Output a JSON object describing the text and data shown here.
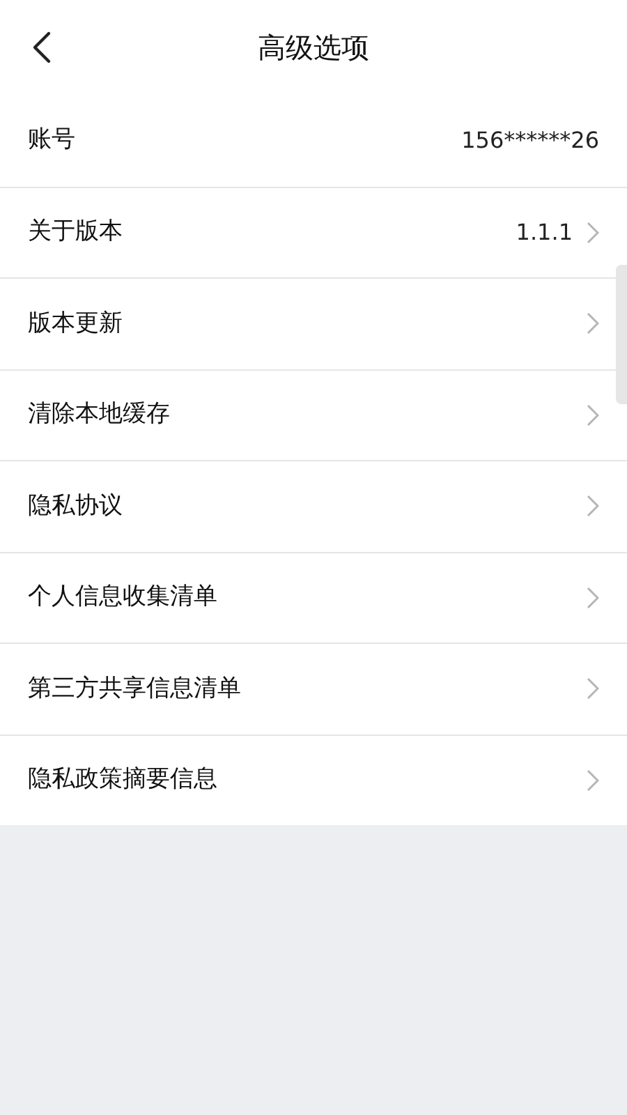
{
  "header": {
    "title": "高级选项"
  },
  "rows": [
    {
      "label": "账号",
      "value": "156******26",
      "kind": "info"
    },
    {
      "label": "关于版本",
      "value": "1.1.1",
      "kind": "link"
    },
    {
      "label": "版本更新",
      "kind": "link"
    },
    {
      "label": "清除本地缓存",
      "kind": "link"
    },
    {
      "label": "隐私协议",
      "kind": "link"
    },
    {
      "label": "个人信息收集清单",
      "kind": "link"
    },
    {
      "label": "第三方共享信息清单",
      "kind": "link"
    },
    {
      "label": "隐私政策摘要信息",
      "kind": "link"
    }
  ]
}
